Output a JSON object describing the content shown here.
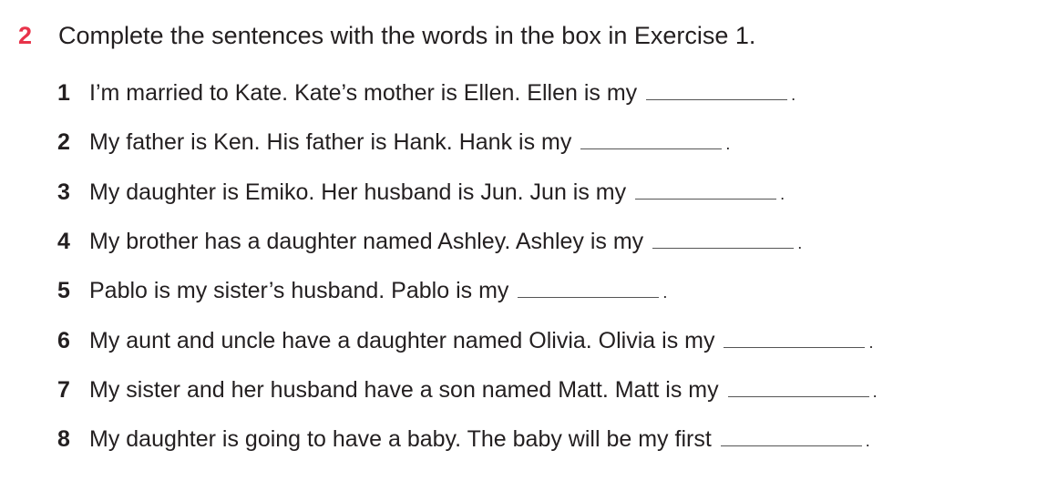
{
  "exercise": {
    "number": "2",
    "instruction": "Complete the sentences with the words in the box in Exercise 1.",
    "items": [
      {
        "n": "1",
        "text": "I’m married to Kate. Kate’s mother is Ellen. Ellen is my",
        "answer": "",
        "end": "."
      },
      {
        "n": "2",
        "text": "My father is Ken. His father is Hank. Hank is my",
        "answer": "",
        "end": "."
      },
      {
        "n": "3",
        "text": "My daughter is Emiko. Her husband is Jun. Jun is my",
        "answer": "",
        "end": "."
      },
      {
        "n": "4",
        "text": "My brother has a daughter named Ashley. Ashley is my",
        "answer": "",
        "end": "."
      },
      {
        "n": "5",
        "text": "Pablo is my sister’s husband. Pablo is my",
        "answer": "",
        "end": "."
      },
      {
        "n": "6",
        "text": "My aunt and uncle have a daughter named Olivia. Olivia is my",
        "answer": "",
        "end": "."
      },
      {
        "n": "7",
        "text": "My sister and her husband have a son named Matt. Matt is my",
        "answer": "",
        "end": "."
      },
      {
        "n": "8",
        "text": "My daughter is going to have a baby. The baby will be my first",
        "answer": "",
        "end": "."
      }
    ]
  },
  "colors": {
    "accent": "#e8334a",
    "text": "#231f20"
  }
}
